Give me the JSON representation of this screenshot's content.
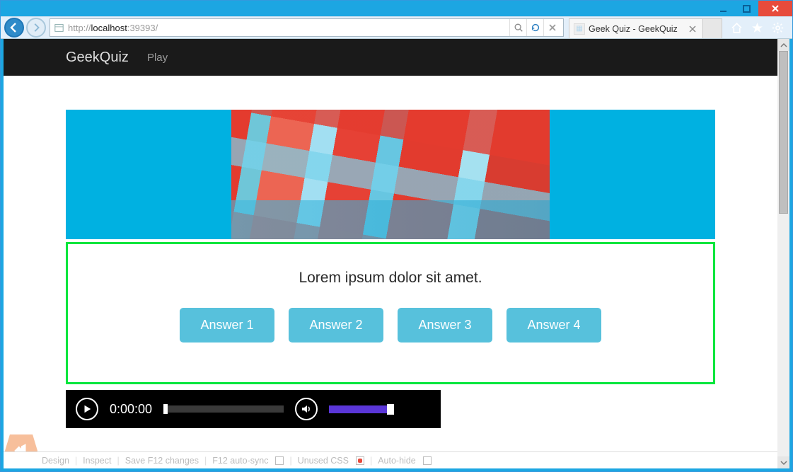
{
  "browser": {
    "url_prefix": "http://",
    "url_host": "localhost",
    "url_port": ":39393/",
    "tab_title": "Geek Quiz - GeekQuiz"
  },
  "app": {
    "brand": "GeekQuiz",
    "nav_play": "Play"
  },
  "quiz": {
    "question": "Lorem ipsum dolor sit amet.",
    "answers": [
      "Answer 1",
      "Answer 2",
      "Answer 3",
      "Answer 4"
    ]
  },
  "media": {
    "time": "0:00:00"
  },
  "devbar": {
    "design": "Design",
    "inspect": "Inspect",
    "save": "Save F12 changes",
    "autosync": "F12 auto-sync",
    "unused": "Unused CSS",
    "autohide": "Auto-hide"
  }
}
